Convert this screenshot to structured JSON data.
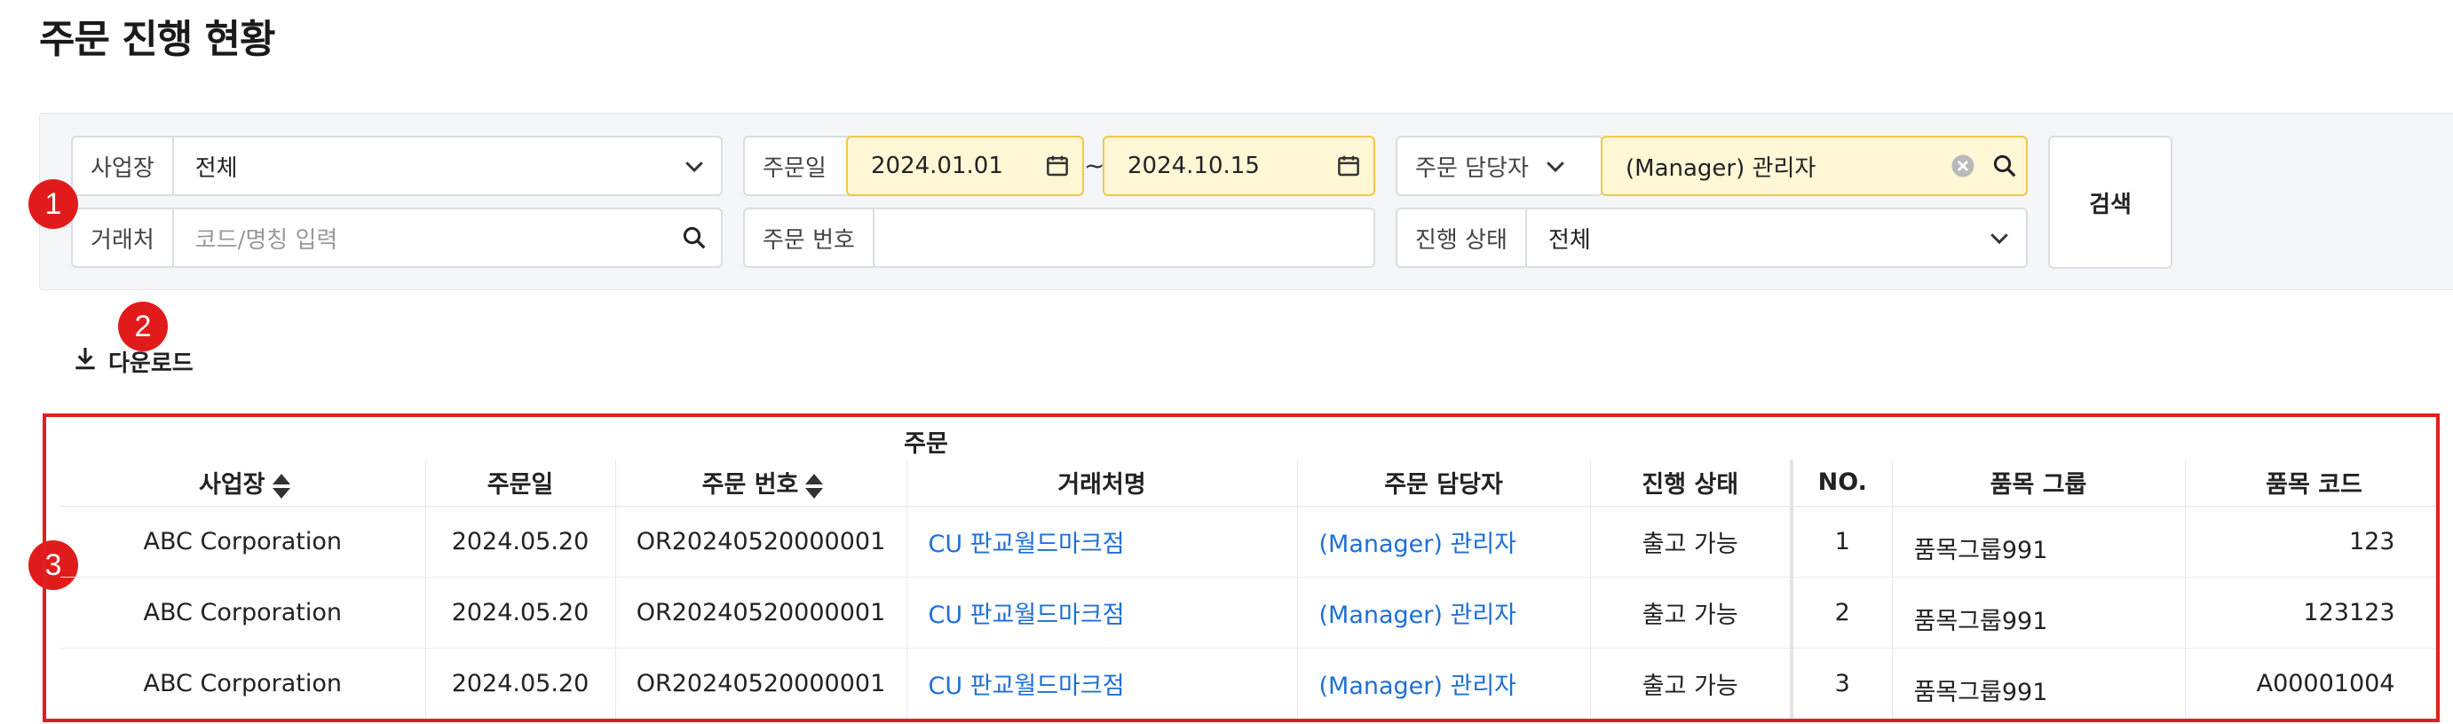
{
  "page": {
    "title": "주문 진행 현황"
  },
  "filters": {
    "business_site": {
      "label": "사업장",
      "value": "전체"
    },
    "order_date": {
      "label": "주문일",
      "from": "2024.01.01",
      "to": "2024.10.15",
      "separator": "~"
    },
    "order_manager": {
      "label": "주문 담당자",
      "value": "(Manager) 관리자"
    },
    "client": {
      "label": "거래처",
      "placeholder": "코드/명칭 입력"
    },
    "order_number": {
      "label": "주문 번호",
      "value": ""
    },
    "status": {
      "label": "진행 상태",
      "value": "전체"
    },
    "search_label": "검색"
  },
  "markers": [
    "1",
    "2",
    "3"
  ],
  "toolbar": {
    "download_label": "다운로드"
  },
  "table": {
    "group_header": "주문",
    "columns": [
      "사업장",
      "주문일",
      "주문 번호",
      "거래처명",
      "주문 담당자",
      "진행 상태",
      "NO.",
      "품목 그룹",
      "품목 코드"
    ],
    "rows": [
      [
        "ABC Corporation",
        "2024.05.20",
        "OR20240520000001",
        "CU 판교월드마크점",
        "(Manager) 관리자",
        "출고 가능",
        "1",
        "품목그룹991",
        "123"
      ],
      [
        "ABC Corporation",
        "2024.05.20",
        "OR20240520000001",
        "CU 판교월드마크점",
        "(Manager) 관리자",
        "출고 가능",
        "2",
        "품목그룹991",
        "123123"
      ],
      [
        "ABC Corporation",
        "2024.05.20",
        "OR20240520000001",
        "CU 판교월드마크점",
        "(Manager) 관리자",
        "출고 가능",
        "3",
        "품목그룹991",
        "A00001004"
      ]
    ]
  },
  "colors": {
    "highlight_bg": "#fff7d6",
    "highlight_border": "#f0c84a",
    "marker": "#e11b1b",
    "link": "#1f6fd6",
    "frame": "#e02020"
  },
  "icons": [
    "chevron-down-icon",
    "calendar-icon",
    "search-icon",
    "clear-icon",
    "download-icon",
    "sort-icon"
  ]
}
